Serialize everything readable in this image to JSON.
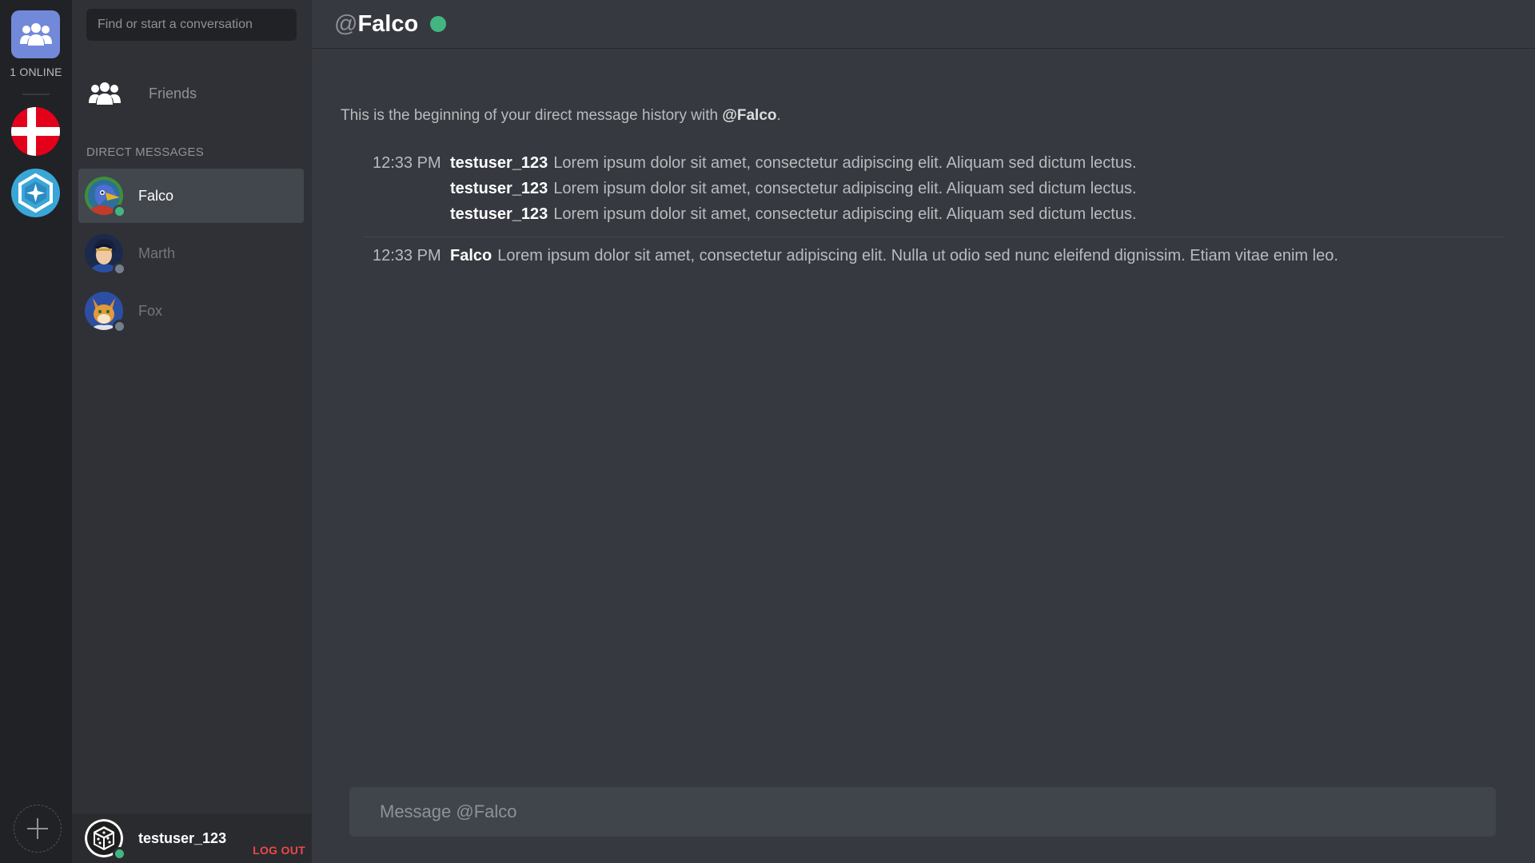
{
  "rail": {
    "online_label": "1 ONLINE"
  },
  "sidebar": {
    "search_placeholder": "Find or start a conversation",
    "friends_label": "Friends",
    "dm_header": "DIRECT MESSAGES",
    "dms": [
      {
        "name": "Falco",
        "status": "online",
        "active": true
      },
      {
        "name": "Marth",
        "status": "offline",
        "active": false
      },
      {
        "name": "Fox",
        "status": "offline",
        "active": false
      }
    ]
  },
  "user_panel": {
    "username": "testuser_123",
    "status": "online",
    "logout_label": "LOG OUT"
  },
  "chat": {
    "at_symbol": "@",
    "recipient": "Falco",
    "recipient_status": "online",
    "history_prefix": "This is the beginning of your direct message history with ",
    "history_handle": "@Falco",
    "history_suffix": ".",
    "groups": [
      {
        "time": "12:33 PM",
        "messages": [
          {
            "author": "testuser_123",
            "text": "Lorem ipsum dolor sit amet, consectetur adipiscing elit. Aliquam sed dictum lectus."
          },
          {
            "author": "testuser_123",
            "text": "Lorem ipsum dolor sit amet, consectetur adipiscing elit. Aliquam sed dictum lectus."
          },
          {
            "author": "testuser_123",
            "text": "Lorem ipsum dolor sit amet, consectetur adipiscing elit. Aliquam sed dictum lectus."
          }
        ]
      },
      {
        "time": "12:33 PM",
        "messages": [
          {
            "author": "Falco",
            "text": "Lorem ipsum dolor sit amet, consectetur adipiscing elit. Nulla ut odio sed nunc eleifend dignissim. Etiam vitae enim leo."
          }
        ]
      }
    ],
    "composer_placeholder": "Message @Falco"
  },
  "colors": {
    "accent": "#7289da",
    "online": "#43b581",
    "offline": "#747f8d",
    "danger": "#f04747"
  },
  "icons": {
    "home": "friends-group-icon",
    "server_1": "danish-flag-icon",
    "server_2": "hexagon-star-icon",
    "add_server": "plus-icon"
  }
}
